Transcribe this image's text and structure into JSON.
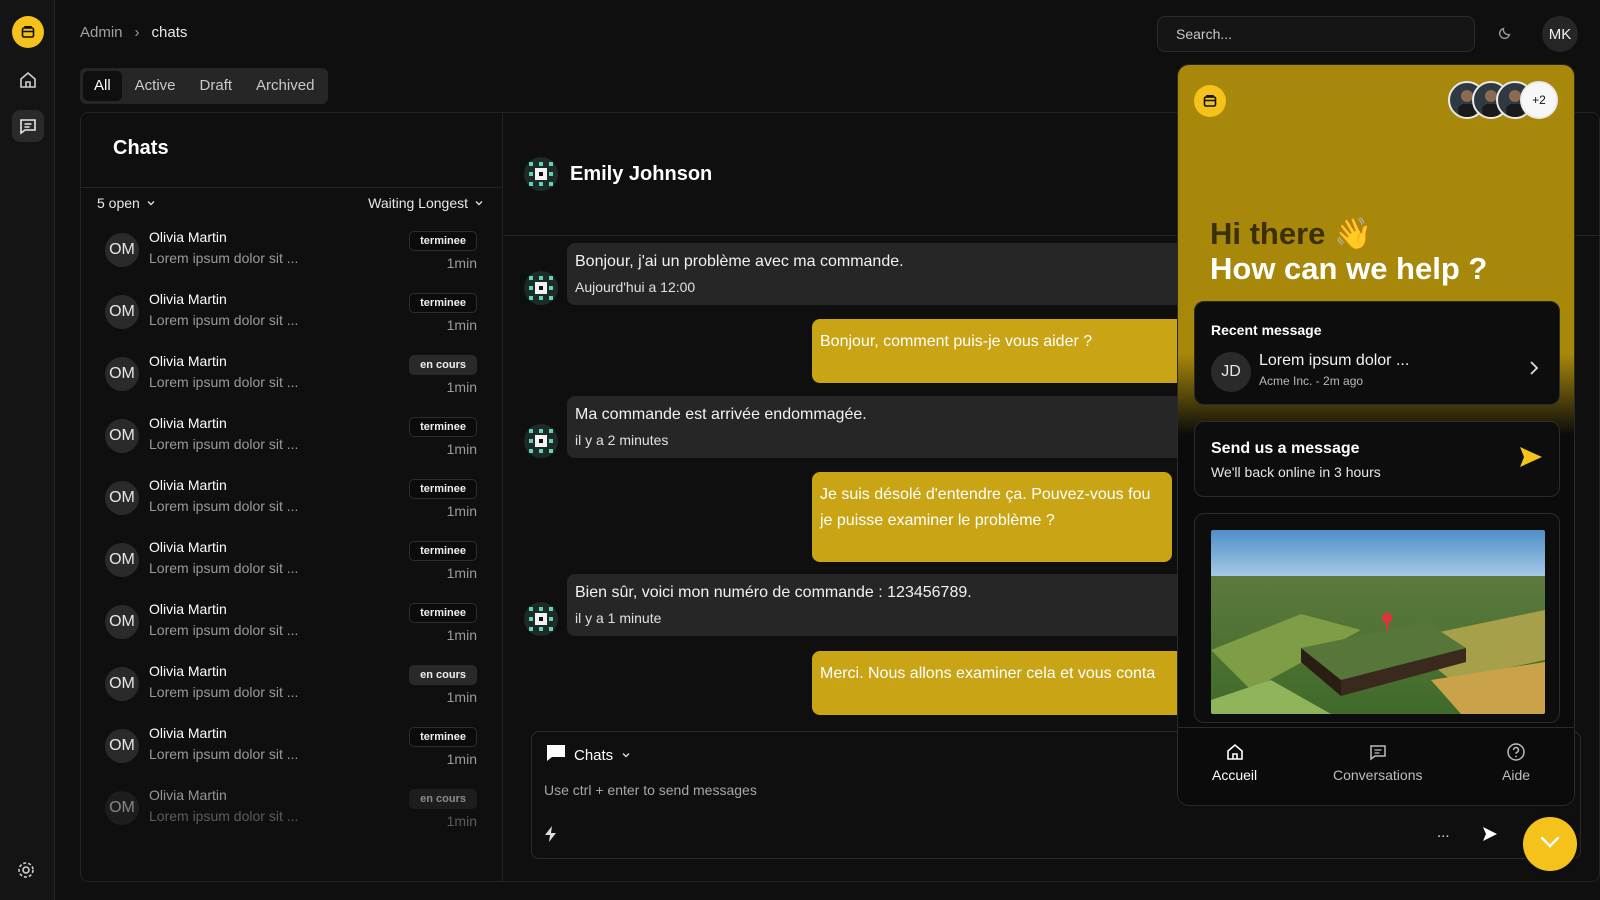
{
  "breadcrumb": {
    "parent": "Admin",
    "current": "chats"
  },
  "search": {
    "placeholder": "Search..."
  },
  "user": {
    "initials": "MK"
  },
  "tabs": [
    {
      "label": "All",
      "active": true
    },
    {
      "label": "Active",
      "active": false
    },
    {
      "label": "Draft",
      "active": false
    },
    {
      "label": "Archived",
      "active": false
    }
  ],
  "chat_list": {
    "title": "Chats",
    "filter_open": "5 open",
    "sort": "Waiting Longest",
    "items": [
      {
        "initials": "OM",
        "name": "Olivia Martin",
        "preview": "Lorem ipsum dolor sit ...",
        "status": "terminee",
        "time": "1min"
      },
      {
        "initials": "OM",
        "name": "Olivia Martin",
        "preview": "Lorem ipsum dolor sit ...",
        "status": "terminee",
        "time": "1min"
      },
      {
        "initials": "OM",
        "name": "Olivia Martin",
        "preview": "Lorem ipsum dolor sit ...",
        "status": "en cours",
        "time": "1min"
      },
      {
        "initials": "OM",
        "name": "Olivia Martin",
        "preview": "Lorem ipsum dolor sit ...",
        "status": "terminee",
        "time": "1min"
      },
      {
        "initials": "OM",
        "name": "Olivia Martin",
        "preview": "Lorem ipsum dolor sit ...",
        "status": "terminee",
        "time": "1min"
      },
      {
        "initials": "OM",
        "name": "Olivia Martin",
        "preview": "Lorem ipsum dolor sit ...",
        "status": "terminee",
        "time": "1min"
      },
      {
        "initials": "OM",
        "name": "Olivia Martin",
        "preview": "Lorem ipsum dolor sit ...",
        "status": "terminee",
        "time": "1min"
      },
      {
        "initials": "OM",
        "name": "Olivia Martin",
        "preview": "Lorem ipsum dolor sit ...",
        "status": "en cours",
        "time": "1min"
      },
      {
        "initials": "OM",
        "name": "Olivia Martin",
        "preview": "Lorem ipsum dolor sit ...",
        "status": "terminee",
        "time": "1min"
      },
      {
        "initials": "OM",
        "name": "Olivia Martin",
        "preview": "Lorem ipsum dolor sit ...",
        "status": "en cours",
        "time": "1min"
      }
    ]
  },
  "conversation": {
    "contact_name": "Emily Johnson",
    "messages": [
      {
        "dir": "in",
        "text": "Bonjour, j'ai un problème avec ma commande.",
        "stamp": "Aujourd'hui a 12:00"
      },
      {
        "dir": "out",
        "text": "Bonjour, comment puis-je vous aider ?"
      },
      {
        "dir": "in",
        "text": "Ma commande est arrivée endommagée.",
        "stamp": "il y a 2 minutes"
      },
      {
        "dir": "out",
        "text": "Je suis désolé d'entendre ça. Pouvez-vous fou je puisse examiner le problème ?"
      },
      {
        "dir": "in",
        "text": "Bien sûr, voici mon numéro de commande : 123456789.",
        "stamp": "il y a 1 minute"
      },
      {
        "dir": "out",
        "text": "Merci. Nous allons examiner cela et vous conta"
      }
    ],
    "composer": {
      "mode": "Chats",
      "placeholder": "Use ctrl + enter to send messages",
      "more": "..."
    }
  },
  "widget": {
    "extra_agents": "+2",
    "greeting": "Hi there 👋",
    "headline": "How can we help ?",
    "recent": {
      "heading": "Recent message",
      "initials": "JD",
      "title": "Lorem ipsum dolor ...",
      "meta": "Acme Inc. - 2m ago"
    },
    "send": {
      "heading": "Send us a message",
      "subtitle": "We'll back online in 3 hours"
    },
    "nav": [
      {
        "label": "Accueil",
        "icon": "home-icon",
        "active": true
      },
      {
        "label": "Conversations",
        "icon": "chat-icon",
        "active": false
      },
      {
        "label": "Aide",
        "icon": "help-icon",
        "active": false
      }
    ]
  },
  "colors": {
    "accent": "#f4c21b",
    "outgoing_bubble": "#c9a414",
    "widget_header": "#a8880a"
  }
}
